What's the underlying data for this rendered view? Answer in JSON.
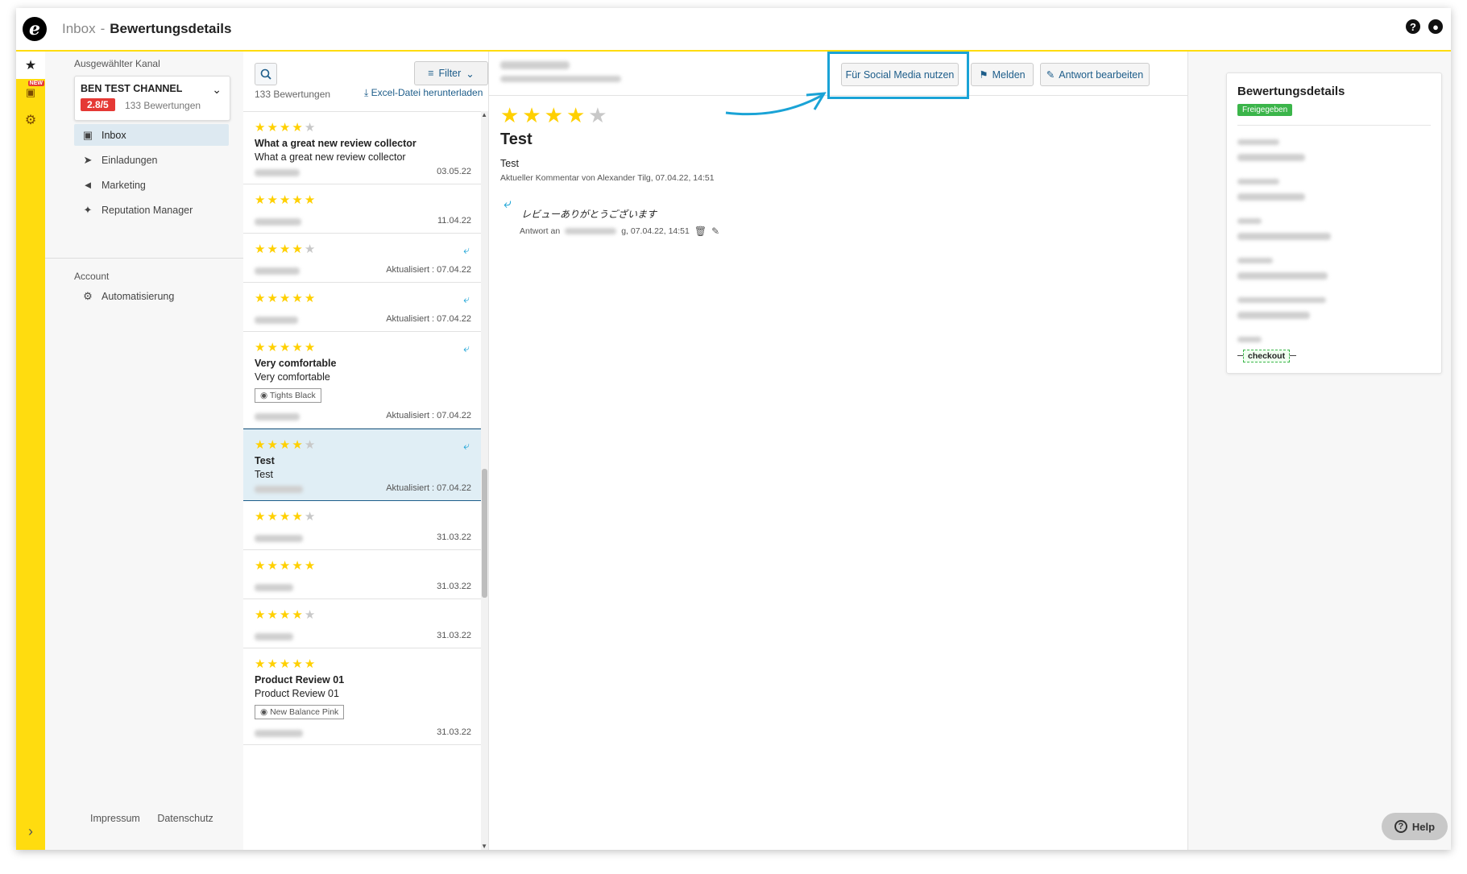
{
  "header": {
    "breadcrumb_parent": "Inbox",
    "breadcrumb_sep": "-",
    "page_title": "Bewertungsdetails",
    "logo_letter": "e"
  },
  "rail": {
    "new_badge": "NEW"
  },
  "sidebar": {
    "channel_label": "Ausgewählter Kanal",
    "channel_name": "BEN TEST CHANNEL",
    "channel_rating": "2.8/5",
    "channel_review_count": "133 Bewertungen",
    "nav_items": [
      {
        "label": "Inbox",
        "icon": "inbox-icon"
      },
      {
        "label": "Einladungen",
        "icon": "send-icon"
      },
      {
        "label": "Marketing",
        "icon": "megaphone-icon"
      },
      {
        "label": "Reputation Manager",
        "icon": "sparkle-icon"
      }
    ],
    "account_label": "Account",
    "account_items": [
      {
        "label": "Automatisierung",
        "icon": "robot-icon"
      }
    ],
    "footer": {
      "impressum": "Impressum",
      "datenschutz": "Datenschutz"
    }
  },
  "review_list": {
    "filter_label": "Filter",
    "count_text": "133 Bewertungen",
    "excel_link": "Excel-Datei herunterladen",
    "items": [
      {
        "stars": 4,
        "title": "What a great new review collector",
        "text": "What a great new review collector",
        "date": "03.05.22",
        "replied": false,
        "tag": ""
      },
      {
        "stars": 5,
        "title": "",
        "text": "",
        "date": "11.04.22",
        "replied": false,
        "tag": ""
      },
      {
        "stars": 4,
        "title": "",
        "text": "",
        "date": "Aktualisiert : 07.04.22",
        "replied": true,
        "tag": ""
      },
      {
        "stars": 5,
        "title": "",
        "text": "",
        "date": "Aktualisiert : 07.04.22",
        "replied": true,
        "tag": ""
      },
      {
        "stars": 5,
        "title": "Very comfortable",
        "text": "Very comfortable",
        "date": "Aktualisiert : 07.04.22",
        "replied": true,
        "tag": "Tights Black"
      },
      {
        "stars": 4,
        "title": "Test",
        "text": "Test",
        "date": "Aktualisiert : 07.04.22",
        "replied": true,
        "tag": "",
        "selected": true
      },
      {
        "stars": 4,
        "title": "",
        "text": "",
        "date": "31.03.22",
        "replied": false,
        "tag": ""
      },
      {
        "stars": 5,
        "title": "",
        "text": "",
        "date": "31.03.22",
        "replied": false,
        "tag": ""
      },
      {
        "stars": 4,
        "title": "",
        "text": "",
        "date": "31.03.22",
        "replied": false,
        "tag": ""
      },
      {
        "stars": 5,
        "title": "Product Review 01",
        "text": "Product Review 01",
        "date": "31.03.22",
        "replied": false,
        "tag": "New Balance Pink"
      }
    ]
  },
  "detail": {
    "buttons": {
      "social_media": "Für Social Media nutzen",
      "report": "Melden",
      "edit_reply": "Antwort bearbeiten"
    },
    "stars": 4,
    "title": "Test",
    "text": "Test",
    "meta": "Aktueller Kommentar von Alexander Tilg, 07.04.22, 14:51",
    "reply_text": "レビューありがとうございます",
    "reply_meta_prefix": "Antwort an",
    "reply_meta_suffix": "g, 07.04.22, 14:51"
  },
  "right_panel": {
    "title": "Bewertungsdetails",
    "status": "Freigegeben",
    "tag": "checkout"
  },
  "help": {
    "label": "Help"
  },
  "colors": {
    "brand_yellow": "#ffdc0f",
    "accent_blue": "#1d5d8a",
    "highlight_cyan": "#1aa3d6",
    "rating_red": "#e53935",
    "status_green": "#3bb54a",
    "star_yellow": "#ffd000"
  }
}
